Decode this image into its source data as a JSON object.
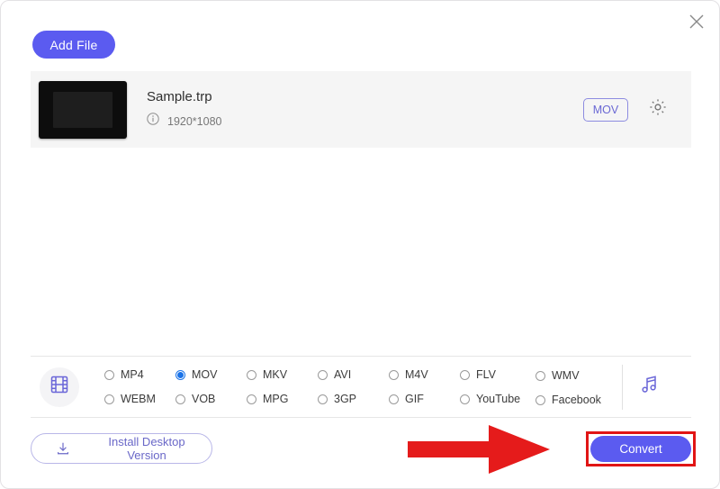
{
  "window": {
    "close_icon": "close-icon"
  },
  "toolbar": {
    "add_file_label": "Add File"
  },
  "file_row": {
    "thumbnail": "video-thumbnail",
    "name": "Sample.trp",
    "info_icon": "info-icon",
    "resolution": "1920*1080",
    "output_format_label": "MOV",
    "settings_icon": "gear-icon"
  },
  "format_bar": {
    "video_icon": "film-strip-icon",
    "audio_icon": "music-note-icon",
    "selected_format": "MOV",
    "formats": [
      {
        "label": "MP4",
        "selected": false
      },
      {
        "label": "MOV",
        "selected": true
      },
      {
        "label": "MKV",
        "selected": false
      },
      {
        "label": "AVI",
        "selected": false
      },
      {
        "label": "M4V",
        "selected": false
      },
      {
        "label": "FLV",
        "selected": false
      },
      {
        "label": "WMV",
        "selected": false
      },
      {
        "label": "WEBM",
        "selected": false
      },
      {
        "label": "VOB",
        "selected": false
      },
      {
        "label": "MPG",
        "selected": false
      },
      {
        "label": "3GP",
        "selected": false
      },
      {
        "label": "GIF",
        "selected": false
      },
      {
        "label": "YouTube",
        "selected": false
      },
      {
        "label": "Facebook",
        "selected": false
      }
    ]
  },
  "footer": {
    "install_label": "Install Desktop Version",
    "install_icon": "download-icon",
    "convert_label": "Convert"
  },
  "annotations": {
    "arrow": "red-arrow-pointing-right",
    "highlight_box": "red-highlight-box",
    "accent_color": "#5b5bf0",
    "annotation_color": "#e11515",
    "radio_selected_color": "#1a73e8"
  }
}
